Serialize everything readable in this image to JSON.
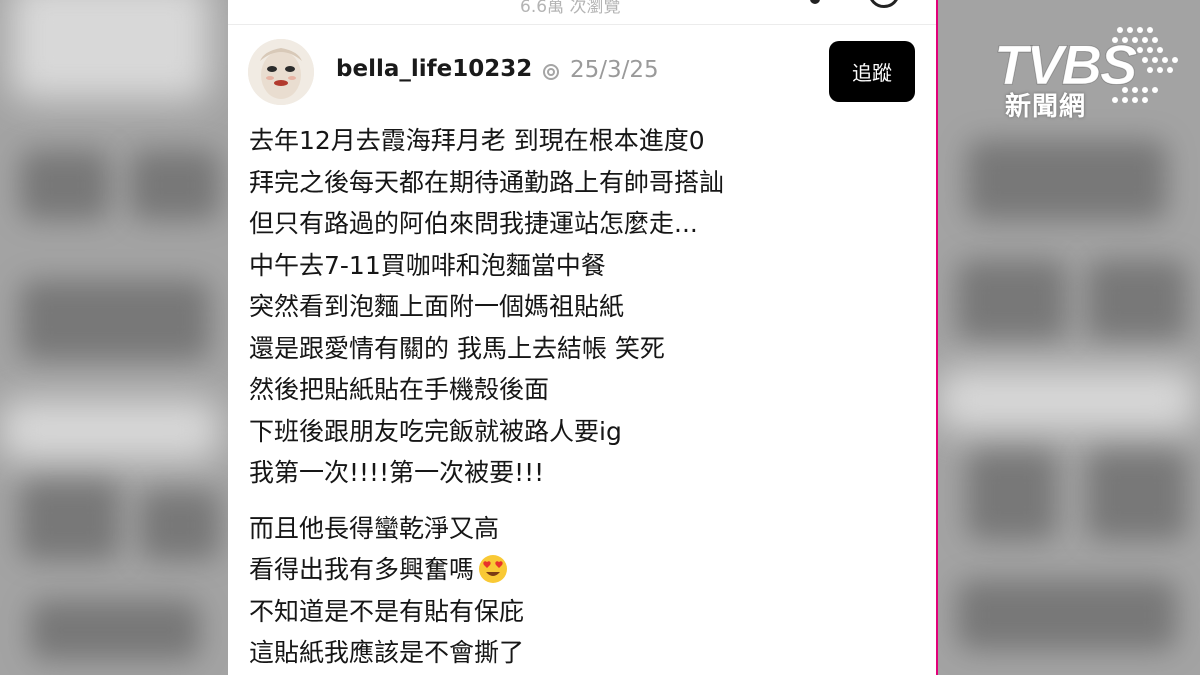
{
  "background": {
    "side_color": "#a3a3a3"
  },
  "header": {
    "views_text": "6.6萬 次瀏覽"
  },
  "post": {
    "username": "bella_life10232",
    "date": "25/3/25",
    "follow_label": "追蹤",
    "lines": [
      "去年12月去霞海拜月老 到現在根本進度0",
      "拜完之後每天都在期待通勤路上有帥哥搭訕",
      "但只有路過的阿伯來問我捷運站怎麼走...",
      "中午去7-11買咖啡和泡麵當中餐",
      "突然看到泡麵上面附一個媽祖貼紙",
      "還是跟愛情有關的 我馬上去結帳 笑死",
      "然後把貼紙貼在手機殼後面",
      "下班後跟朋友吃完飯就被路人要ig",
      "我第一次!!!!第一次被要!!!",
      "而且他長得蠻乾淨又高",
      "看得出我有多興奮嗎",
      "不知道是不是有貼有保庇",
      "這貼紙我應該是不會撕了"
    ],
    "emoji_name": "heart-eyes-emoji"
  },
  "watermark": {
    "brand": "TVBS",
    "subtitle": "新聞網"
  },
  "colors": {
    "accent_edge": "#e2007a",
    "follow_bg": "#000000"
  }
}
